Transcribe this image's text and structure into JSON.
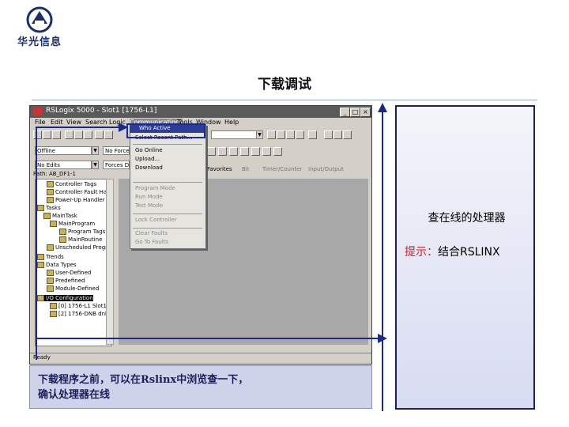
{
  "logo": {
    "text": "华光信息"
  },
  "slide": {
    "title": "下载调试"
  },
  "window": {
    "title": "RSLogix 5000 - Slot1 [1756-L1]",
    "menu": [
      "File",
      "Edit",
      "View",
      "Search",
      "Logic",
      "Communications",
      "Tools",
      "Window",
      "Help"
    ],
    "active_menu_index": 5,
    "buttons": {
      "minimize": "_",
      "maximize": "□",
      "close": "×"
    }
  },
  "toolbar": {
    "mode_value": "Offline",
    "force_value": "No Forces",
    "edits_value": "No Edits",
    "forces_disabled": "Forces Disabled",
    "path_value": "Path: AB_DF1-1",
    "tabs": [
      "Favorites",
      "Bit",
      "Timer/Counter",
      "Input/Output"
    ]
  },
  "tree": {
    "items": [
      "Controller Tags",
      "Controller Fault Handler",
      "Power-Up Handler",
      "Tasks",
      "MainTask",
      "MainProgram",
      "Program Tags",
      "MainRoutine",
      "Unscheduled Program",
      "Trends",
      "Data Types",
      "User-Defined",
      "Predefined",
      "Module-Defined",
      "I/O Configuration",
      "[0] 1756-L1 Slot1",
      "[2] 1756-DNB dnb"
    ]
  },
  "dropdown": {
    "items": [
      {
        "label": "Who Active",
        "disabled": false,
        "highlight": true
      },
      {
        "label": "Select Recent Path...",
        "disabled": false
      },
      {
        "sep": true
      },
      {
        "label": "Go Online",
        "disabled": false
      },
      {
        "label": "Upload...",
        "disabled": false
      },
      {
        "label": "Download",
        "disabled": false
      },
      {
        "sep": true
      },
      {
        "label": "Program Mode",
        "disabled": true
      },
      {
        "label": "Run Mode",
        "disabled": true
      },
      {
        "label": "Test Mode",
        "disabled": true
      },
      {
        "sep": true
      },
      {
        "label": "Lock Controller",
        "disabled": true
      },
      {
        "sep": true
      },
      {
        "label": "Clear Faults",
        "disabled": true
      },
      {
        "label": "Go To Faults",
        "disabled": true
      }
    ]
  },
  "status": {
    "text": "Ready"
  },
  "caption": {
    "line1": "下载程序之前，可以在Rslinx中浏览查一下，",
    "line2": "确认处理器在线"
  },
  "panel": {
    "heading": "查在线的处理器",
    "hint_label": "提示：",
    "hint_body": "结合RSLINX"
  },
  "colors": {
    "accent": "#1a2a8a",
    "hint_red": "#d42020",
    "menu_highlight": "#2f3c96"
  }
}
